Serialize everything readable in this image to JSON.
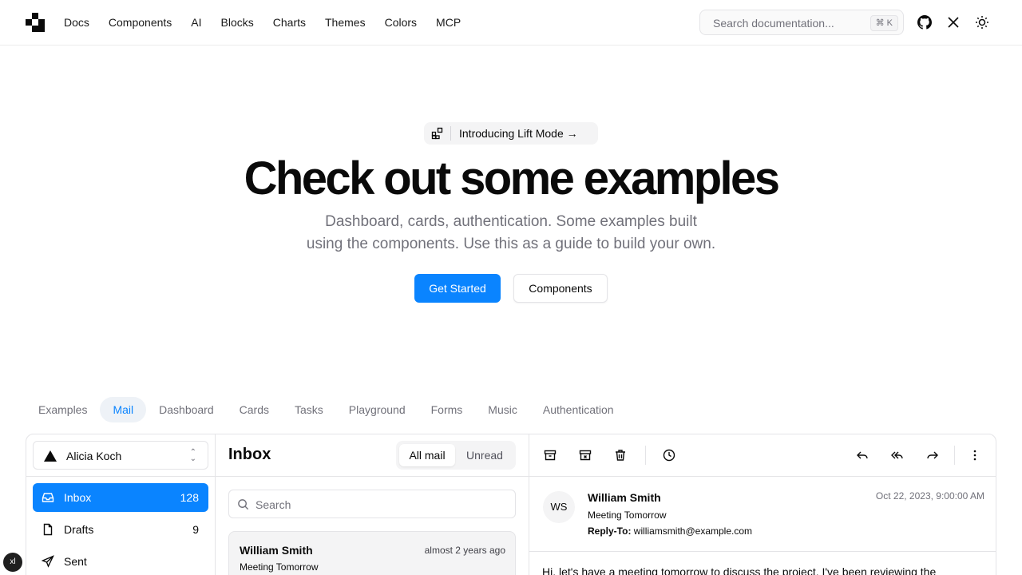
{
  "nav": {
    "items": [
      "Docs",
      "Components",
      "AI",
      "Blocks",
      "Charts",
      "Themes",
      "Colors",
      "MCP"
    ],
    "search_placeholder": "Search documentation...",
    "search_shortcut": "⌘ K",
    "icons": [
      "github-icon",
      "x-icon",
      "sun-icon"
    ]
  },
  "hero": {
    "announcement": "Introducing Lift Mode →",
    "title": "Check out some examples",
    "subtitle_line1": "Dashboard, cards, authentication. Some examples built",
    "subtitle_line2": "using the components. Use this as a guide to build your own.",
    "primary_button": "Get Started",
    "secondary_button": "Components"
  },
  "example_tabs": [
    "Examples",
    "Mail",
    "Dashboard",
    "Cards",
    "Tasks",
    "Playground",
    "Forms",
    "Music",
    "Authentication"
  ],
  "example_tabs_active": "Mail",
  "mail": {
    "account": "Alicia Koch",
    "folders": [
      {
        "label": "Inbox",
        "count": "128",
        "active": true
      },
      {
        "label": "Drafts",
        "count": "9",
        "active": false
      },
      {
        "label": "Sent",
        "count": "",
        "active": false
      }
    ],
    "list_title": "Inbox",
    "filter_all": "All mail",
    "filter_unread": "Unread",
    "search_placeholder": "Search",
    "messages": [
      {
        "from": "William Smith",
        "when": "almost 2 years ago",
        "subject": "Meeting Tomorrow"
      }
    ],
    "reader": {
      "initials": "WS",
      "from": "William Smith",
      "subject": "Meeting Tomorrow",
      "reply_to_label": "Reply-To:",
      "reply_to": "williamsmith@example.com",
      "date": "Oct 22, 2023, 9:00:00 AM",
      "body": "Hi, let's have a meeting tomorrow to discuss the project. I've been reviewing the"
    }
  },
  "badge": "xl",
  "colors": {
    "accent": "#0a84ff",
    "muted": "#71717a",
    "border": "#e4e4e7"
  }
}
